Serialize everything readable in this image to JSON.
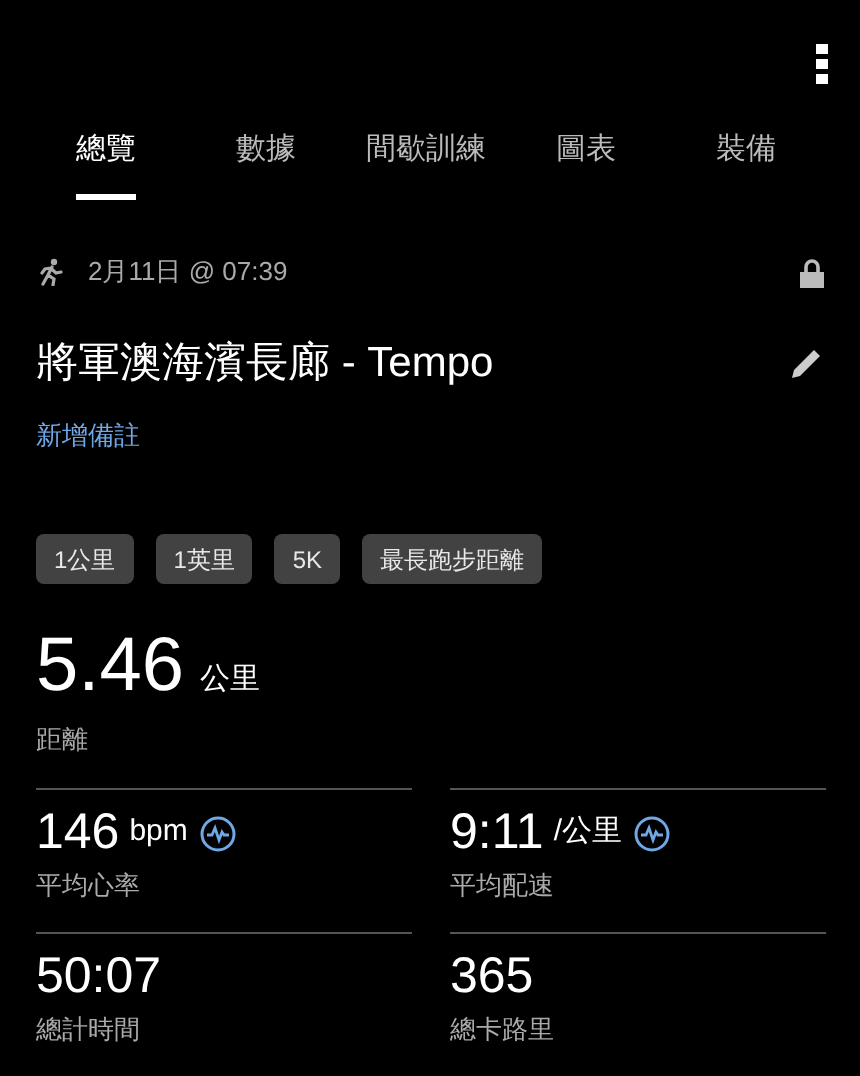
{
  "tabs": [
    {
      "label": "總覽",
      "selected": true
    },
    {
      "label": "數據",
      "selected": false
    },
    {
      "label": "間歇訓練",
      "selected": false
    },
    {
      "label": "圖表",
      "selected": false
    },
    {
      "label": "裝備",
      "selected": false
    }
  ],
  "activity": {
    "date": "2月11日 @ 07:39",
    "title": "將軍澳海濱長廊 - Tempo",
    "add_note": "新增備註"
  },
  "chips": [
    "1公里",
    "1英里",
    "5K",
    "最長跑步距離"
  ],
  "distance": {
    "value": "5.46",
    "unit": "公里",
    "label": "距離"
  },
  "stats": [
    {
      "value": "146",
      "unit": "bpm",
      "label": "平均心率",
      "pulse_icon": true
    },
    {
      "value": "9:11",
      "unit": "/公里",
      "label": "平均配速",
      "pulse_icon": true
    },
    {
      "value": "50:07",
      "label": "總計時間",
      "pulse_icon": false
    },
    {
      "value": "365",
      "label": "總卡路里",
      "pulse_icon": false
    }
  ]
}
